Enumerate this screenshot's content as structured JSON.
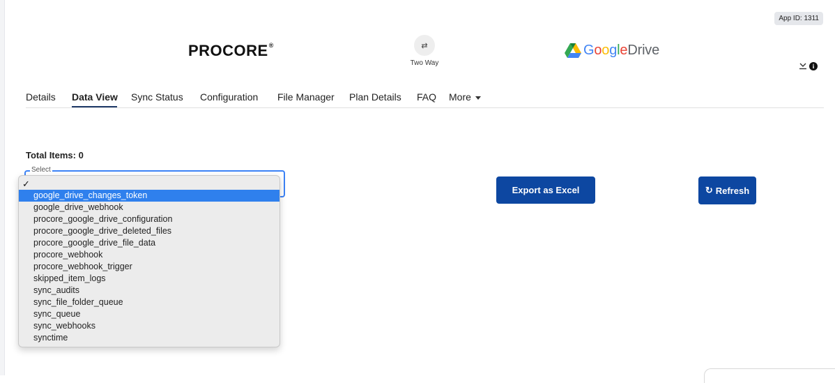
{
  "header": {
    "app_id": "App ID: 1311",
    "left_logo_text": "PROCORE",
    "left_logo_reg": "®",
    "sync_icon": "⇄",
    "sync_label": "Two Way",
    "right_logo": {
      "part1": "G",
      "part2": "o",
      "part3": "o",
      "part4": "g",
      "part5": "l",
      "part6": "e",
      "part7": "Drive"
    }
  },
  "tabs": [
    {
      "label": "Details"
    },
    {
      "label": "Data View",
      "active": true
    },
    {
      "label": "Sync Status"
    },
    {
      "label": "Configuration"
    },
    {
      "label": "File Manager"
    },
    {
      "label": "Plan Details"
    },
    {
      "label": "FAQ"
    },
    {
      "label": "More"
    }
  ],
  "main": {
    "total_items": "Total Items: 0",
    "select_label": "Select",
    "dropdown": {
      "check": "✓",
      "options": [
        "google_drive_changes_token",
        "google_drive_webhook",
        "procore_google_drive_configuration",
        "procore_google_drive_deleted_files",
        "procore_google_drive_file_data",
        "procore_webhook",
        "procore_webhook_trigger",
        "skipped_item_logs",
        "sync_audits",
        "sync_file_folder_queue",
        "sync_queue",
        "sync_webhooks",
        "synctime"
      ],
      "selected_index": 0
    },
    "export_label": "Export as Excel",
    "refresh_label": "Refresh",
    "refresh_icon": "↻"
  },
  "colors": {
    "primary_button": "#0d47a1",
    "selected_option": "#2f80ed",
    "select_border": "#3b82f6"
  }
}
